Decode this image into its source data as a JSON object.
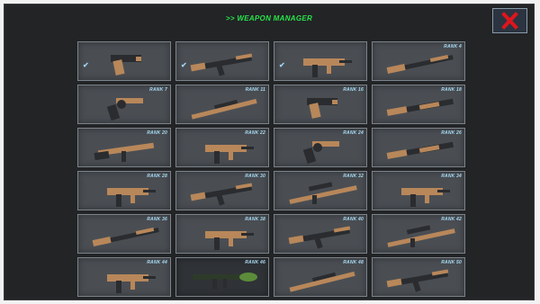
{
  "title": ">> WEAPON MANAGER",
  "close_icon": "close-x-icon",
  "colors": {
    "title": "#29e34a",
    "rank": "#a9dcf5",
    "close": "#e0151b",
    "wood": "#b8875a",
    "metal": "#2a2c2f"
  },
  "weapons": [
    {
      "rank": "",
      "owned": true,
      "icon": "pistol-icon"
    },
    {
      "rank": "",
      "owned": true,
      "icon": "assault-rifle-icon"
    },
    {
      "rank": "",
      "owned": true,
      "icon": "smg-icon"
    },
    {
      "rank": "RANK 4",
      "owned": false,
      "icon": "rifle-icon"
    },
    {
      "rank": "RANK 7",
      "owned": false,
      "icon": "revolver-icon"
    },
    {
      "rank": "RANK 11",
      "owned": false,
      "icon": "hunting-rifle-icon"
    },
    {
      "rank": "RANK 16",
      "owned": false,
      "icon": "pistol-icon"
    },
    {
      "rank": "RANK 18",
      "owned": false,
      "icon": "shotgun-icon"
    },
    {
      "rank": "RANK 20",
      "owned": false,
      "icon": "carbine-icon"
    },
    {
      "rank": "RANK 22",
      "owned": false,
      "icon": "smg-icon"
    },
    {
      "rank": "RANK 24",
      "owned": false,
      "icon": "revolver-icon"
    },
    {
      "rank": "RANK 26",
      "owned": false,
      "icon": "shotgun-icon"
    },
    {
      "rank": "RANK 28",
      "owned": false,
      "icon": "smg-icon"
    },
    {
      "rank": "RANK 30",
      "owned": false,
      "icon": "assault-rifle-icon"
    },
    {
      "rank": "RANK 32",
      "owned": false,
      "icon": "sniper-rifle-icon"
    },
    {
      "rank": "RANK 34",
      "owned": false,
      "icon": "smg-icon"
    },
    {
      "rank": "RANK 36",
      "owned": false,
      "icon": "rifle-icon"
    },
    {
      "rank": "RANK 38",
      "owned": false,
      "icon": "smg-icon"
    },
    {
      "rank": "RANK 40",
      "owned": false,
      "icon": "assault-rifle-icon"
    },
    {
      "rank": "RANK 42",
      "owned": false,
      "icon": "sniper-rifle-icon"
    },
    {
      "rank": "RANK 44",
      "owned": false,
      "icon": "smg-icon"
    },
    {
      "rank": "RANK 46",
      "owned": false,
      "icon": "rocket-launcher-icon"
    },
    {
      "rank": "RANK 48",
      "owned": false,
      "icon": "hunting-rifle-icon"
    },
    {
      "rank": "RANK 50",
      "owned": false,
      "icon": "assault-rifle-icon"
    }
  ]
}
